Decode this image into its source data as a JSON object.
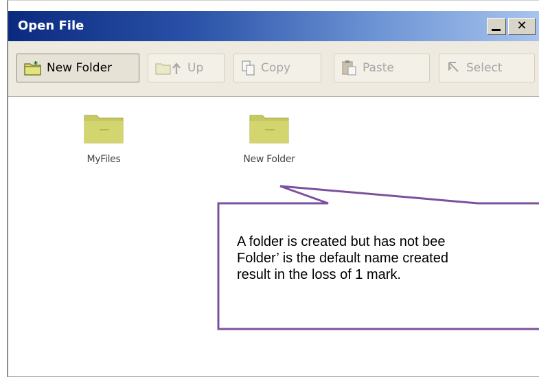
{
  "window": {
    "title": "Open File",
    "minimize_glyph": "",
    "close_glyph": "✕"
  },
  "toolbar": {
    "new_folder": {
      "label": "New Folder",
      "icon": "new-folder-icon",
      "enabled": true
    },
    "up": {
      "label": "Up",
      "icon": "up-folder-icon",
      "enabled": false
    },
    "copy": {
      "label": "Copy",
      "icon": "copy-icon",
      "enabled": false
    },
    "paste": {
      "label": "Paste",
      "icon": "paste-icon",
      "enabled": false
    },
    "select": {
      "label": "Select",
      "icon": "select-cursor-icon",
      "enabled": false
    }
  },
  "files": [
    {
      "name": "MyFiles",
      "icon": "folder-icon"
    },
    {
      "name": "New Folder",
      "icon": "folder-icon"
    }
  ],
  "callout": {
    "lines": [
      "A folder is created but has not bee",
      "Folder’ is the default name created",
      "result in the loss of 1 mark."
    ],
    "border_color": "#7b519d"
  },
  "colors": {
    "titlebar_dark": "#0a2a80",
    "titlebar_light": "#a8c4ee",
    "folder": "#cfd36a"
  }
}
